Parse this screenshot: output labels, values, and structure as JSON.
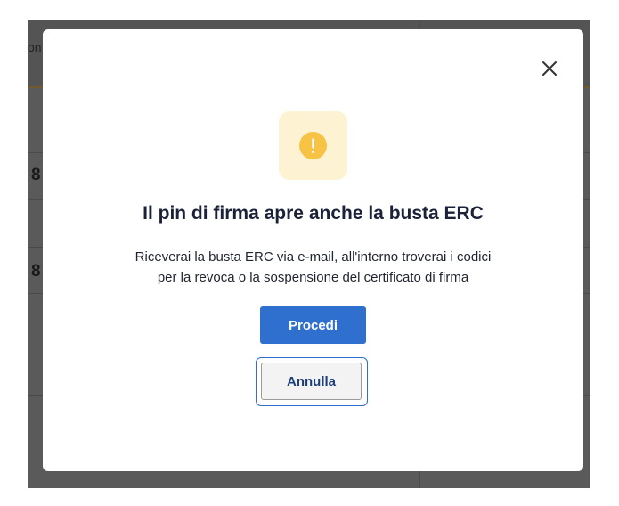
{
  "background": {
    "top_text": "on",
    "row_digits": [
      "8",
      "8"
    ]
  },
  "modal": {
    "close_icon": "close-icon",
    "warning_icon": "exclamation-icon",
    "title": "Il pin di firma apre anche la busta ERC",
    "body_line_1": "Riceverai la busta ERC via e-mail, all'interno troverai i codici",
    "body_line_2": "per la revoca o la sospensione del certificato di firma",
    "primary_button": "Procedi",
    "secondary_button": "Annulla"
  },
  "colors": {
    "overlay": "#5a5a5a",
    "primary": "#2f6fce",
    "warning": "#f6c344",
    "warning_bg": "#fdf3d3"
  }
}
